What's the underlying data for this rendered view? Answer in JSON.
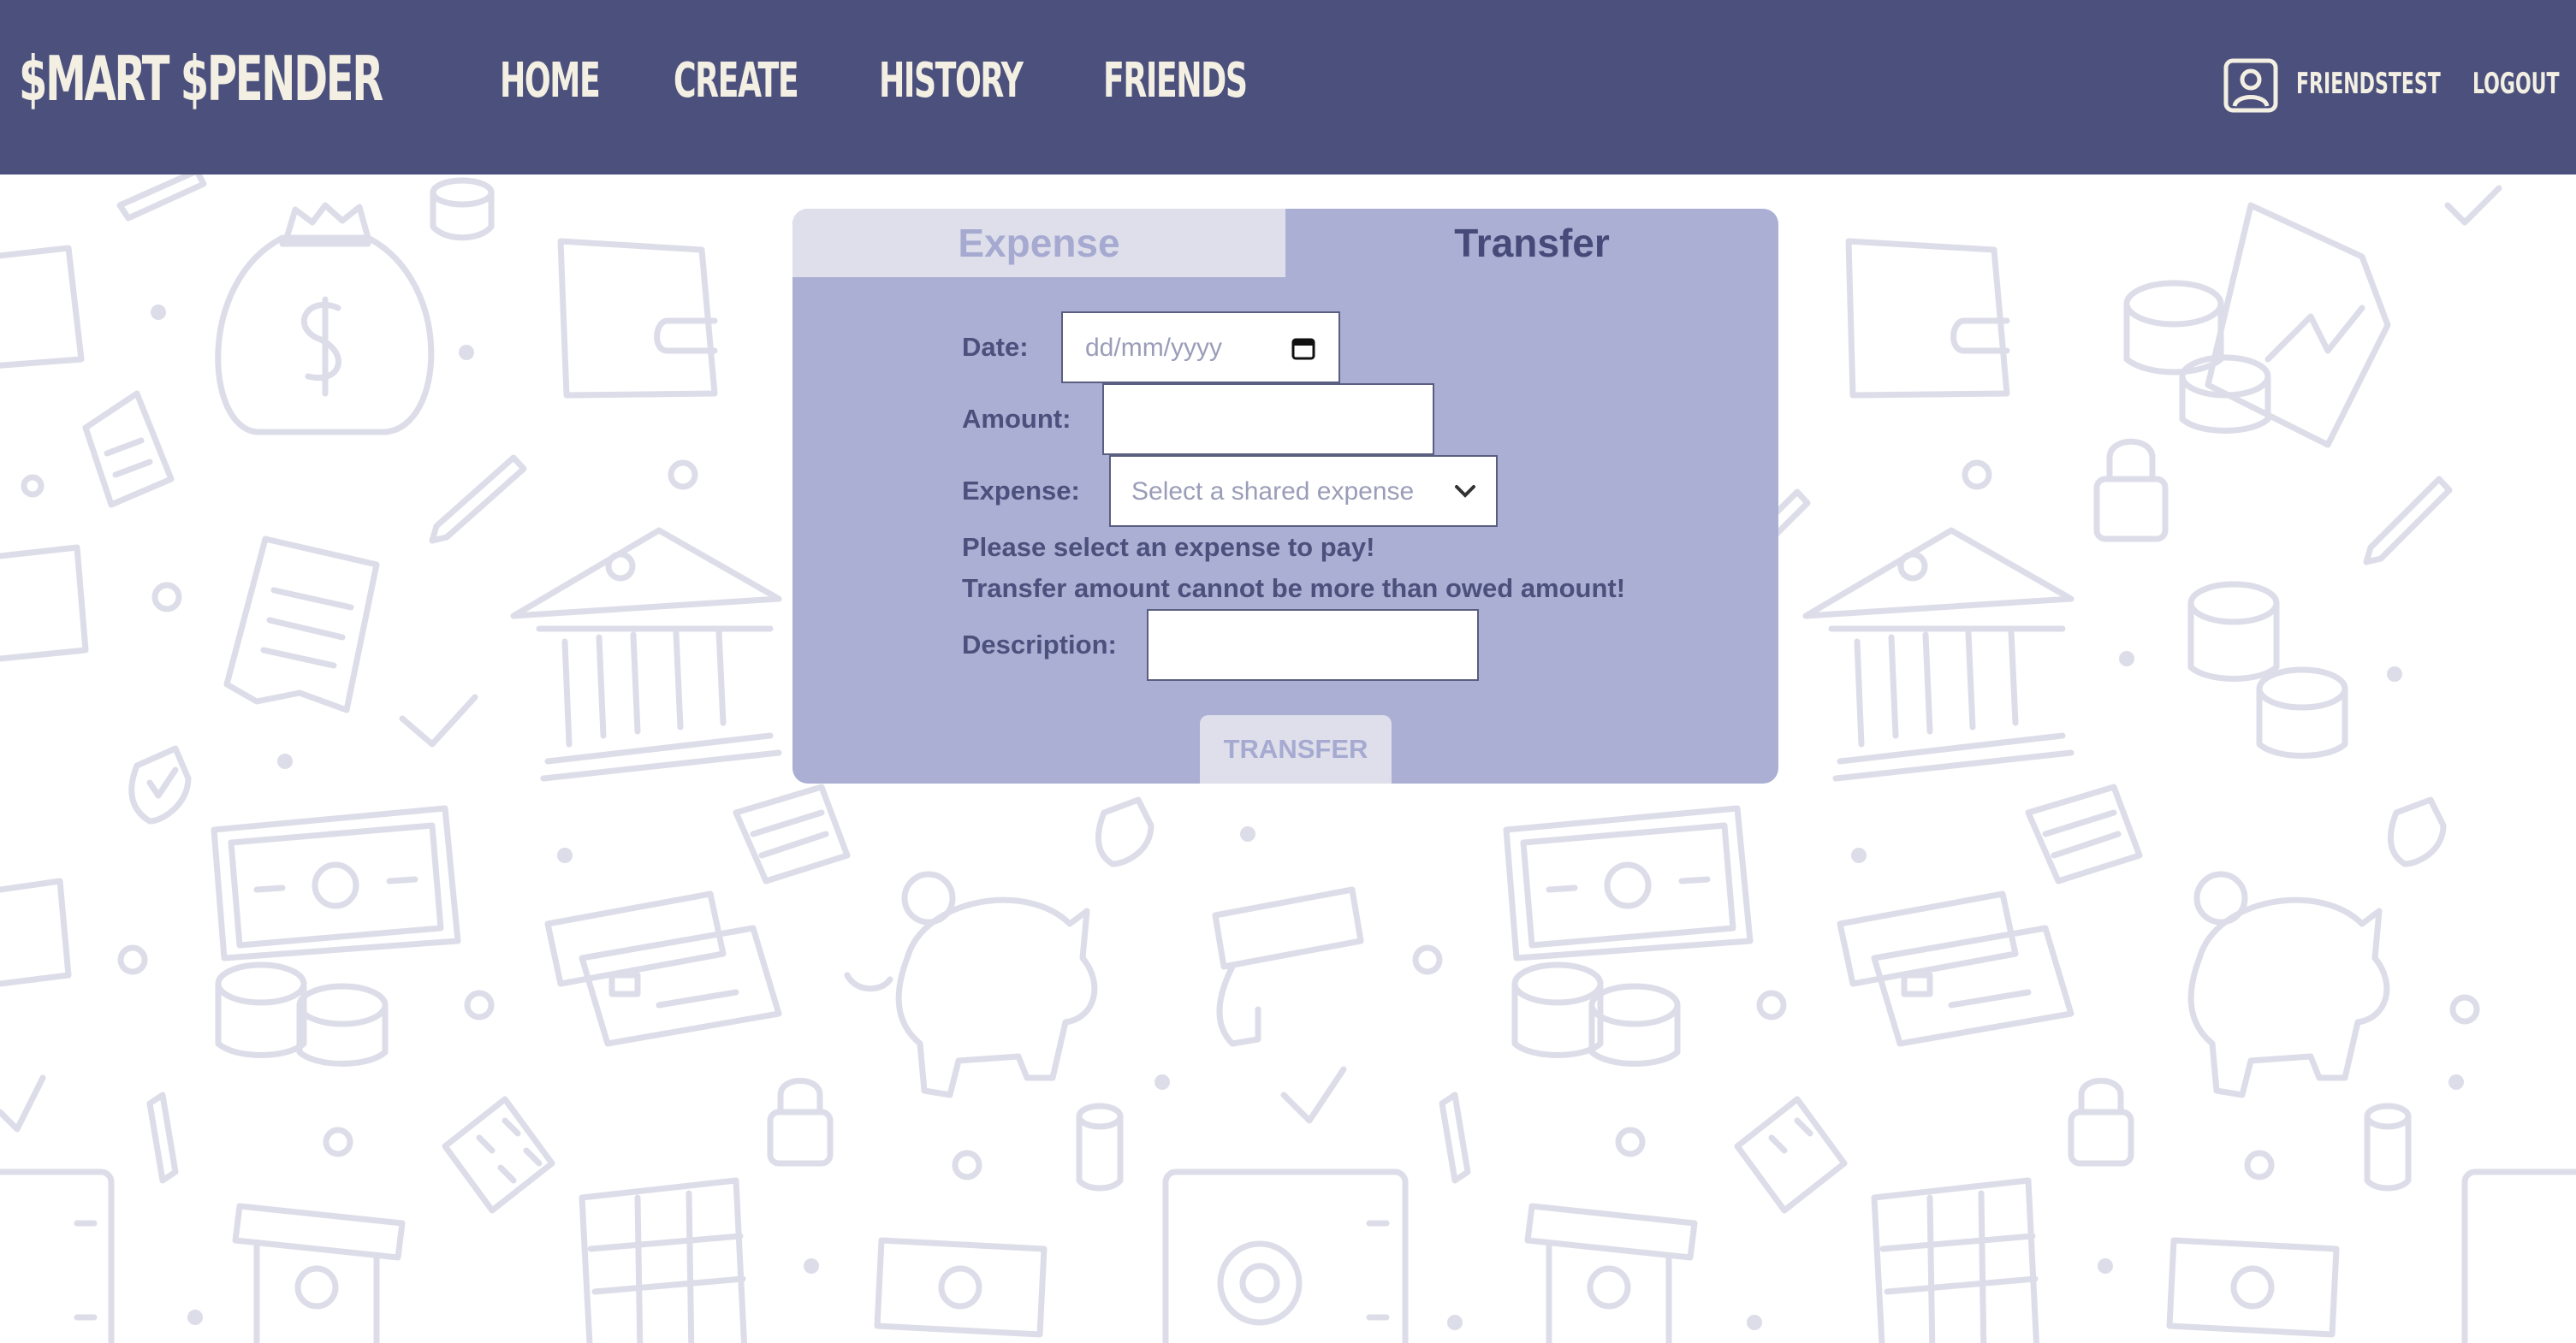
{
  "header": {
    "brand": "$MART $PENDER",
    "nav": [
      "HOME",
      "CREATE",
      "HISTORY",
      "FRIENDS"
    ],
    "user_icon": "user-icon",
    "username": "FRIENDSTEST",
    "logout": "LOGOUT"
  },
  "form": {
    "tabs": {
      "expense": "Expense",
      "transfer": "Transfer",
      "active": "Transfer"
    },
    "date_label": "Date:",
    "date_placeholder": "dd/mm/yyyy",
    "date_icon": "calendar-icon",
    "amount_label": "Amount:",
    "amount_value": "",
    "expense_label": "Expense:",
    "expense_placeholder": "Select a shared expense",
    "expense_icon": "chevron-down-icon",
    "errors": [
      "Please select an expense to pay!",
      "Transfer amount cannot be more than owed amount!"
    ],
    "description_label": "Description:",
    "description_value": "",
    "submit": "TRANSFER"
  },
  "colors": {
    "nav_bg": "#4b507c",
    "nav_text": "#f3efe3",
    "card_bg": "#abafd4",
    "tab_inactive": "#dedfea",
    "accent_text": "#4b507c",
    "doodle": "#dcdde8"
  }
}
